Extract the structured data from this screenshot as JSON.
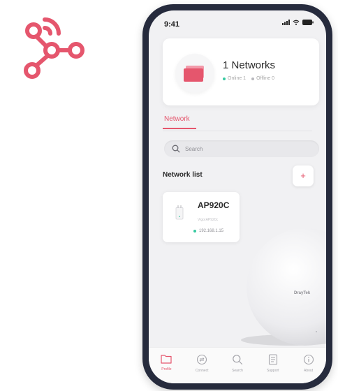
{
  "status_bar": {
    "time": "9:41"
  },
  "summary": {
    "title": "1 Networks",
    "online_label": "Online 1",
    "offline_label": "Offline 0"
  },
  "tabs": [
    {
      "label": "Network",
      "active": true
    }
  ],
  "search": {
    "placeholder": "Search",
    "value": ""
  },
  "network_list": {
    "title": "Network list",
    "add_label": "+",
    "devices": [
      {
        "name": "AP920C",
        "subtitle": "VigorAP920c",
        "ip": "192.168.1.15",
        "status": "online",
        "icon": "access-point-icon"
      }
    ]
  },
  "product_visual": {
    "icon": "access-point-device",
    "brand_text": "DrayTek"
  },
  "bottom_nav": {
    "items": [
      {
        "label": "Profile",
        "icon": "folder-icon",
        "active": true
      },
      {
        "label": "Connect",
        "icon": "connect-icon",
        "active": false
      },
      {
        "label": "Search",
        "icon": "search-icon",
        "active": false
      },
      {
        "label": "Support",
        "icon": "document-icon",
        "active": false
      },
      {
        "label": "About",
        "icon": "info-icon",
        "active": false
      }
    ]
  },
  "colors": {
    "accent": "#e5566d",
    "online": "#36c9a0",
    "offline": "#b8b8bd",
    "phone_frame": "#262b3d",
    "screen_bg": "#f1f1f3"
  }
}
